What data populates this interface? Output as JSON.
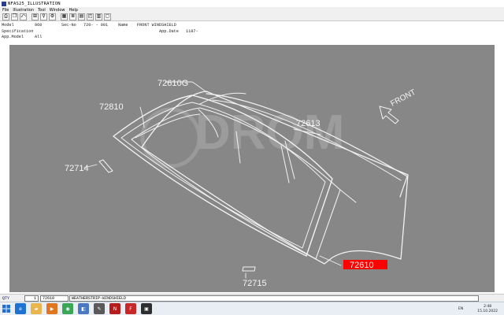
{
  "window": {
    "title": "NFAS25_ILLUSTRATION"
  },
  "menu": [
    "File",
    "Illustration",
    "Tool",
    "Window",
    "Help"
  ],
  "toolbar": [
    {
      "name": "print-icon",
      "glyph": "⎙"
    },
    {
      "name": "copy-icon",
      "glyph": "❐"
    },
    {
      "name": "back-icon",
      "glyph": "⤺"
    },
    {
      "name": "zoom-fit-icon",
      "glyph": "⊞"
    },
    {
      "name": "search-icon",
      "glyph": "⚲"
    },
    {
      "name": "settings-icon",
      "glyph": "⚙"
    },
    {
      "name": "grid-icon",
      "glyph": "▦"
    },
    {
      "name": "list-icon",
      "glyph": "≣"
    },
    {
      "name": "tiles-icon",
      "glyph": "▤"
    },
    {
      "name": "diagram-icon",
      "glyph": "◰"
    },
    {
      "name": "table-icon",
      "glyph": "▥"
    },
    {
      "name": "frame-icon",
      "glyph": "▢"
    }
  ],
  "info": {
    "model_label": "Model",
    "model_value": "960",
    "sec_label": "Sec-No",
    "sec_value": "720- - 001",
    "name_label": "Name",
    "name_value": "FRONT WINDSHIELD",
    "spec_label": "Specification",
    "appdate_label": "App.Date",
    "appdate_value": "1187-",
    "appmodel_label": "App.Model",
    "appmodel_value": "All"
  },
  "illustration": {
    "labels": {
      "p72610G": "72610G",
      "p72810": "72810",
      "p72613": "72613",
      "front": "FRONT",
      "p72714": "72714",
      "p72610": "72610",
      "p72715": "72715"
    },
    "watermark": "DROM",
    "highlight_color": "#ff0000",
    "canvas_color": "#878787"
  },
  "status": {
    "qty_label": "QTY",
    "qty_value": "1",
    "part_no": "72610",
    "description": "WEATHERSTRIP-WINDSHIELD"
  },
  "taskbar": {
    "lang": "EN",
    "time": "2:48",
    "date": "15.10.2022",
    "apps": [
      {
        "name": "ie-icon",
        "color": "#1e73d2",
        "glyph": "e"
      },
      {
        "name": "folder-icon",
        "color": "#e8b64c",
        "glyph": "▰"
      },
      {
        "name": "media-icon",
        "color": "#e0761f",
        "glyph": "▶"
      },
      {
        "name": "chrome-icon",
        "color": "#3aa757",
        "glyph": "◉"
      },
      {
        "name": "viewer-icon",
        "color": "#4a78c2",
        "glyph": "◧"
      },
      {
        "name": "tool-icon",
        "color": "#5a5a5a",
        "glyph": "✎"
      },
      {
        "name": "nissan-icon",
        "color": "#b71c1c",
        "glyph": "N"
      },
      {
        "name": "fast-icon",
        "color": "#c62828",
        "glyph": "F"
      },
      {
        "name": "terminal-icon",
        "color": "#2e2e2e",
        "glyph": "▣"
      }
    ]
  }
}
